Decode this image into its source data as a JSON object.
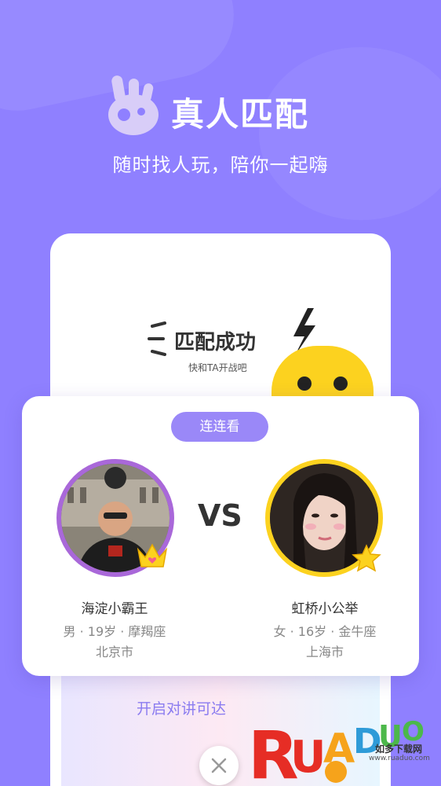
{
  "hero": {
    "title": "真人匹配",
    "subtitle": "随时找人玩，陪你一起嗨"
  },
  "match_card": {
    "title": "匹配成功",
    "subtitle": "快和TA开战吧"
  },
  "game": {
    "pill_label": "连连看",
    "vs_label": "VS"
  },
  "players": [
    {
      "name": "海淀小霸王",
      "meta": "男 · 19岁 · 摩羯座",
      "city": "北京市",
      "badge": "crown-icon"
    },
    {
      "name": "虹桥小公举",
      "meta": "女 · 16岁 · 金牛座",
      "city": "上海市",
      "badge": "star-icon"
    }
  ],
  "bottom": {
    "hint": "开启对讲可达"
  },
  "watermark": {
    "caption": "如多下载网",
    "url": "www.ruaduo.com"
  },
  "colors": {
    "background": "#8f80ff",
    "accent": "#9a88f8",
    "mascot": "#fcd21f",
    "male_ring": "#a968d9"
  }
}
